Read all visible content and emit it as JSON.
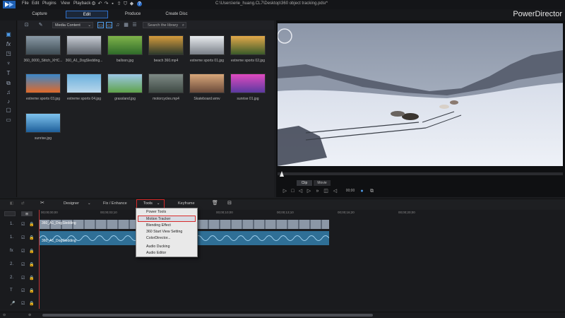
{
  "titlebar": {
    "menus": [
      "File",
      "Edit",
      "Plugins",
      "View",
      "Playback"
    ],
    "path": "C:\\Users\\erie_huang.CL7\\Desktop\\360 object tracking.pdsr*"
  },
  "modes": {
    "capture": "Capture",
    "edit": "Edit",
    "produce": "Produce",
    "create_disc": "Create Disc"
  },
  "brand": "PowerDirector",
  "library": {
    "media_select": "Media Content",
    "search_placeholder": "Search the library",
    "items": [
      {
        "caption": "360_0000_Stitch_XHC...",
        "c1": "#8a9aa6",
        "c2": "#3d4a52"
      },
      {
        "caption": "360_A1_DogSledding...",
        "c1": "#c7ccd4",
        "c2": "#5a6068"
      },
      {
        "caption": "balloon.jpg",
        "c1": "#7fb34a",
        "c2": "#2e6a2a"
      },
      {
        "caption": "beach 360.mp4",
        "c1": "#d59b3c",
        "c2": "#2d3a2c"
      },
      {
        "caption": "extreme sports 01.jpg",
        "c1": "#e9ecef",
        "c2": "#7a8088"
      },
      {
        "caption": "extreme sports 02.jpg",
        "c1": "#e3a94a",
        "c2": "#3a5a2a"
      },
      {
        "caption": "extreme sports 03.jpg",
        "c1": "#3a87c9",
        "c2": "#e06a2a"
      },
      {
        "caption": "extreme sports 04.jpg",
        "c1": "#6ab0de",
        "c2": "#b8d6ea"
      },
      {
        "caption": "grassland.jpg",
        "c1": "#9cc7e6",
        "c2": "#5fa34a"
      },
      {
        "caption": "motorcycles.mp4",
        "c1": "#7e8a86",
        "c2": "#3f4a44"
      },
      {
        "caption": "Skateboard.wmv",
        "c1": "#d9a77a",
        "c2": "#6a4a3a"
      },
      {
        "caption": "sunrise 01.jpg",
        "c1": "#e04ac0",
        "c2": "#5a3aa0"
      },
      {
        "caption": "sunrise.jpg",
        "c1": "#7ec3ee",
        "c2": "#1e5f9a"
      }
    ]
  },
  "preview": {
    "clip": "Clip",
    "movie": "Movie"
  },
  "timeline": {
    "designer": "Designer",
    "fix_enhance": "Fix / Enhance",
    "tools": "Tools",
    "keyframe": "Keyframe",
    "ruler": [
      "00;00;00;00",
      "00;00;03;10",
      "00;00;06;20",
      "00;00;10;00",
      "00;00;13;10",
      "00;00;16;20",
      "00;00;20;00"
    ],
    "tracks": [
      "1.",
      "1.",
      "fx",
      "2.",
      "2.",
      "T",
      "🎤"
    ],
    "video_clip": "360_A1_DogSledding",
    "audio_clip": "360_A1_DogSledding"
  },
  "dropdown": {
    "items": [
      "Power Tools",
      "Motion Tracker",
      "Blending Effect",
      "360 Start View Setting",
      "ColorDirector...",
      "Audio Ducking",
      "Audio Editor"
    ]
  },
  "colors": {
    "accent": "#2f6fc9",
    "highlight": "#d92b2b",
    "playhead": "#c23434"
  }
}
